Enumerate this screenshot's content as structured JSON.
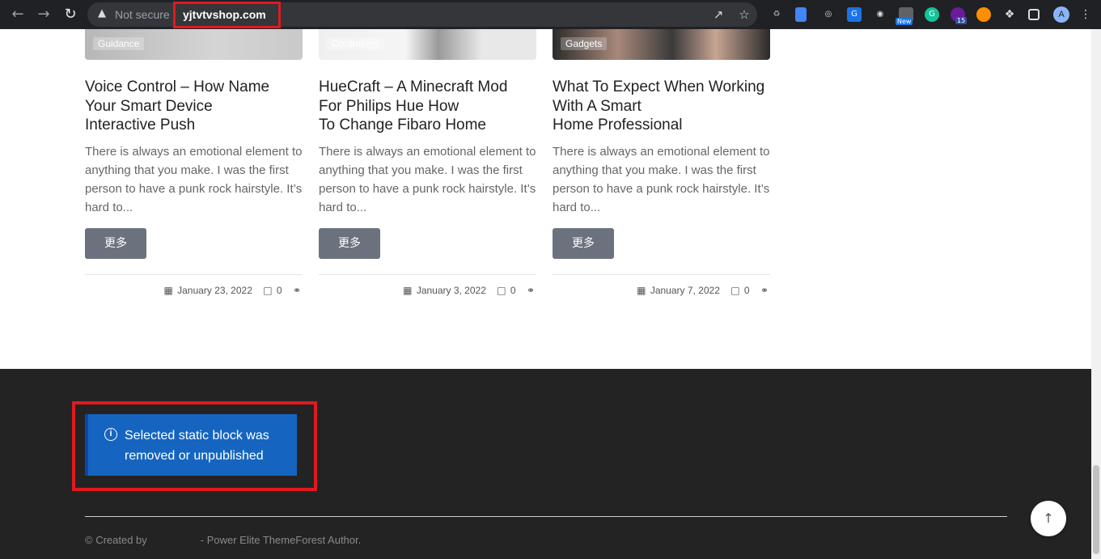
{
  "browser": {
    "security_label": "Not secure",
    "url": "yjtvtvshop.com",
    "icons": {
      "back": "arrow-left-icon",
      "forward": "arrow-right-icon",
      "reload": "reload-icon",
      "share": "share-icon",
      "bookmark": "star-icon",
      "extensions": "puzzle-icon",
      "side_panel": "side-panel-icon",
      "menu": "kebab-menu-icon"
    },
    "extension_badges": {
      "new": "New",
      "count": "15"
    },
    "profile_initial": "A"
  },
  "posts": [
    {
      "category": "Guidance",
      "title_lines": [
        "Voice Control – How Name",
        "Your Smart Device",
        "Interactive Push"
      ],
      "excerpt": "There is always an emotional element to anything that you make. I was the first person to have a punk rock hairstyle. It’s hard to...",
      "more_label": "更多",
      "date": "January 23, 2022",
      "comments": "0"
    },
    {
      "category": "Controllers",
      "title_lines": [
        "HueCraft – A Minecraft Mod",
        "For Philips Hue How",
        "To Change Fibaro Home"
      ],
      "excerpt": "There is always an emotional element to anything that you make. I was the first person to have a punk rock hairstyle. It’s hard to...",
      "more_label": "更多",
      "date": "January 3, 2022",
      "comments": "0"
    },
    {
      "category": "Gadgets",
      "title_lines": [
        "What To Expect When Working",
        "With A Smart",
        "Home Professional"
      ],
      "excerpt": "There is always an emotional element to anything that you make. I was the first person to have a punk rock hairstyle. It’s hard to...",
      "more_label": "更多",
      "date": "January 7, 2022",
      "comments": "0"
    }
  ],
  "footer": {
    "notice": "Selected static block was removed or unpublished",
    "copyright_prefix": "© Created by",
    "copyright_suffix": "- Power Elite ThemeForest Author."
  },
  "colors": {
    "highlight": "#e0191f",
    "notice_bg": "#1565c0",
    "footer_bg": "#232323",
    "button_bg": "#6c727d"
  }
}
